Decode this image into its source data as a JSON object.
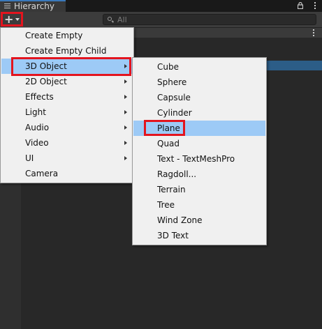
{
  "tab": {
    "title": "Hierarchy"
  },
  "search": {
    "placeholder": "All"
  },
  "main_menu": {
    "items": [
      {
        "label": "Create Empty",
        "has_submenu": false
      },
      {
        "label": "Create Empty Child",
        "has_submenu": false
      },
      {
        "label": "3D Object",
        "has_submenu": true,
        "highlighted": true
      },
      {
        "label": "2D Object",
        "has_submenu": true
      },
      {
        "label": "Effects",
        "has_submenu": true
      },
      {
        "label": "Light",
        "has_submenu": true
      },
      {
        "label": "Audio",
        "has_submenu": true
      },
      {
        "label": "Video",
        "has_submenu": true
      },
      {
        "label": "UI",
        "has_submenu": true
      },
      {
        "label": "Camera",
        "has_submenu": false
      }
    ]
  },
  "submenu_3d": {
    "items": [
      {
        "label": "Cube"
      },
      {
        "label": "Sphere"
      },
      {
        "label": "Capsule"
      },
      {
        "label": "Cylinder"
      },
      {
        "label": "Plane",
        "highlighted": true
      },
      {
        "label": "Quad"
      },
      {
        "label": "Text - TextMeshPro"
      },
      {
        "label": "Ragdoll..."
      },
      {
        "label": "Terrain"
      },
      {
        "label": "Tree"
      },
      {
        "label": "Wind Zone"
      },
      {
        "label": "3D Text"
      }
    ]
  },
  "colors": {
    "highlight_box": "#e3141e",
    "menu_hover": "#9dcaf6",
    "menu_bg": "#f0f0f0",
    "panel_bg": "#282828",
    "selection": "#2c5d87"
  },
  "icons": [
    "hamburger-icon",
    "lock-icon",
    "kebab-menu-icon",
    "plus-icon",
    "caret-down-icon",
    "search-icon",
    "chevron-right-icon"
  ]
}
